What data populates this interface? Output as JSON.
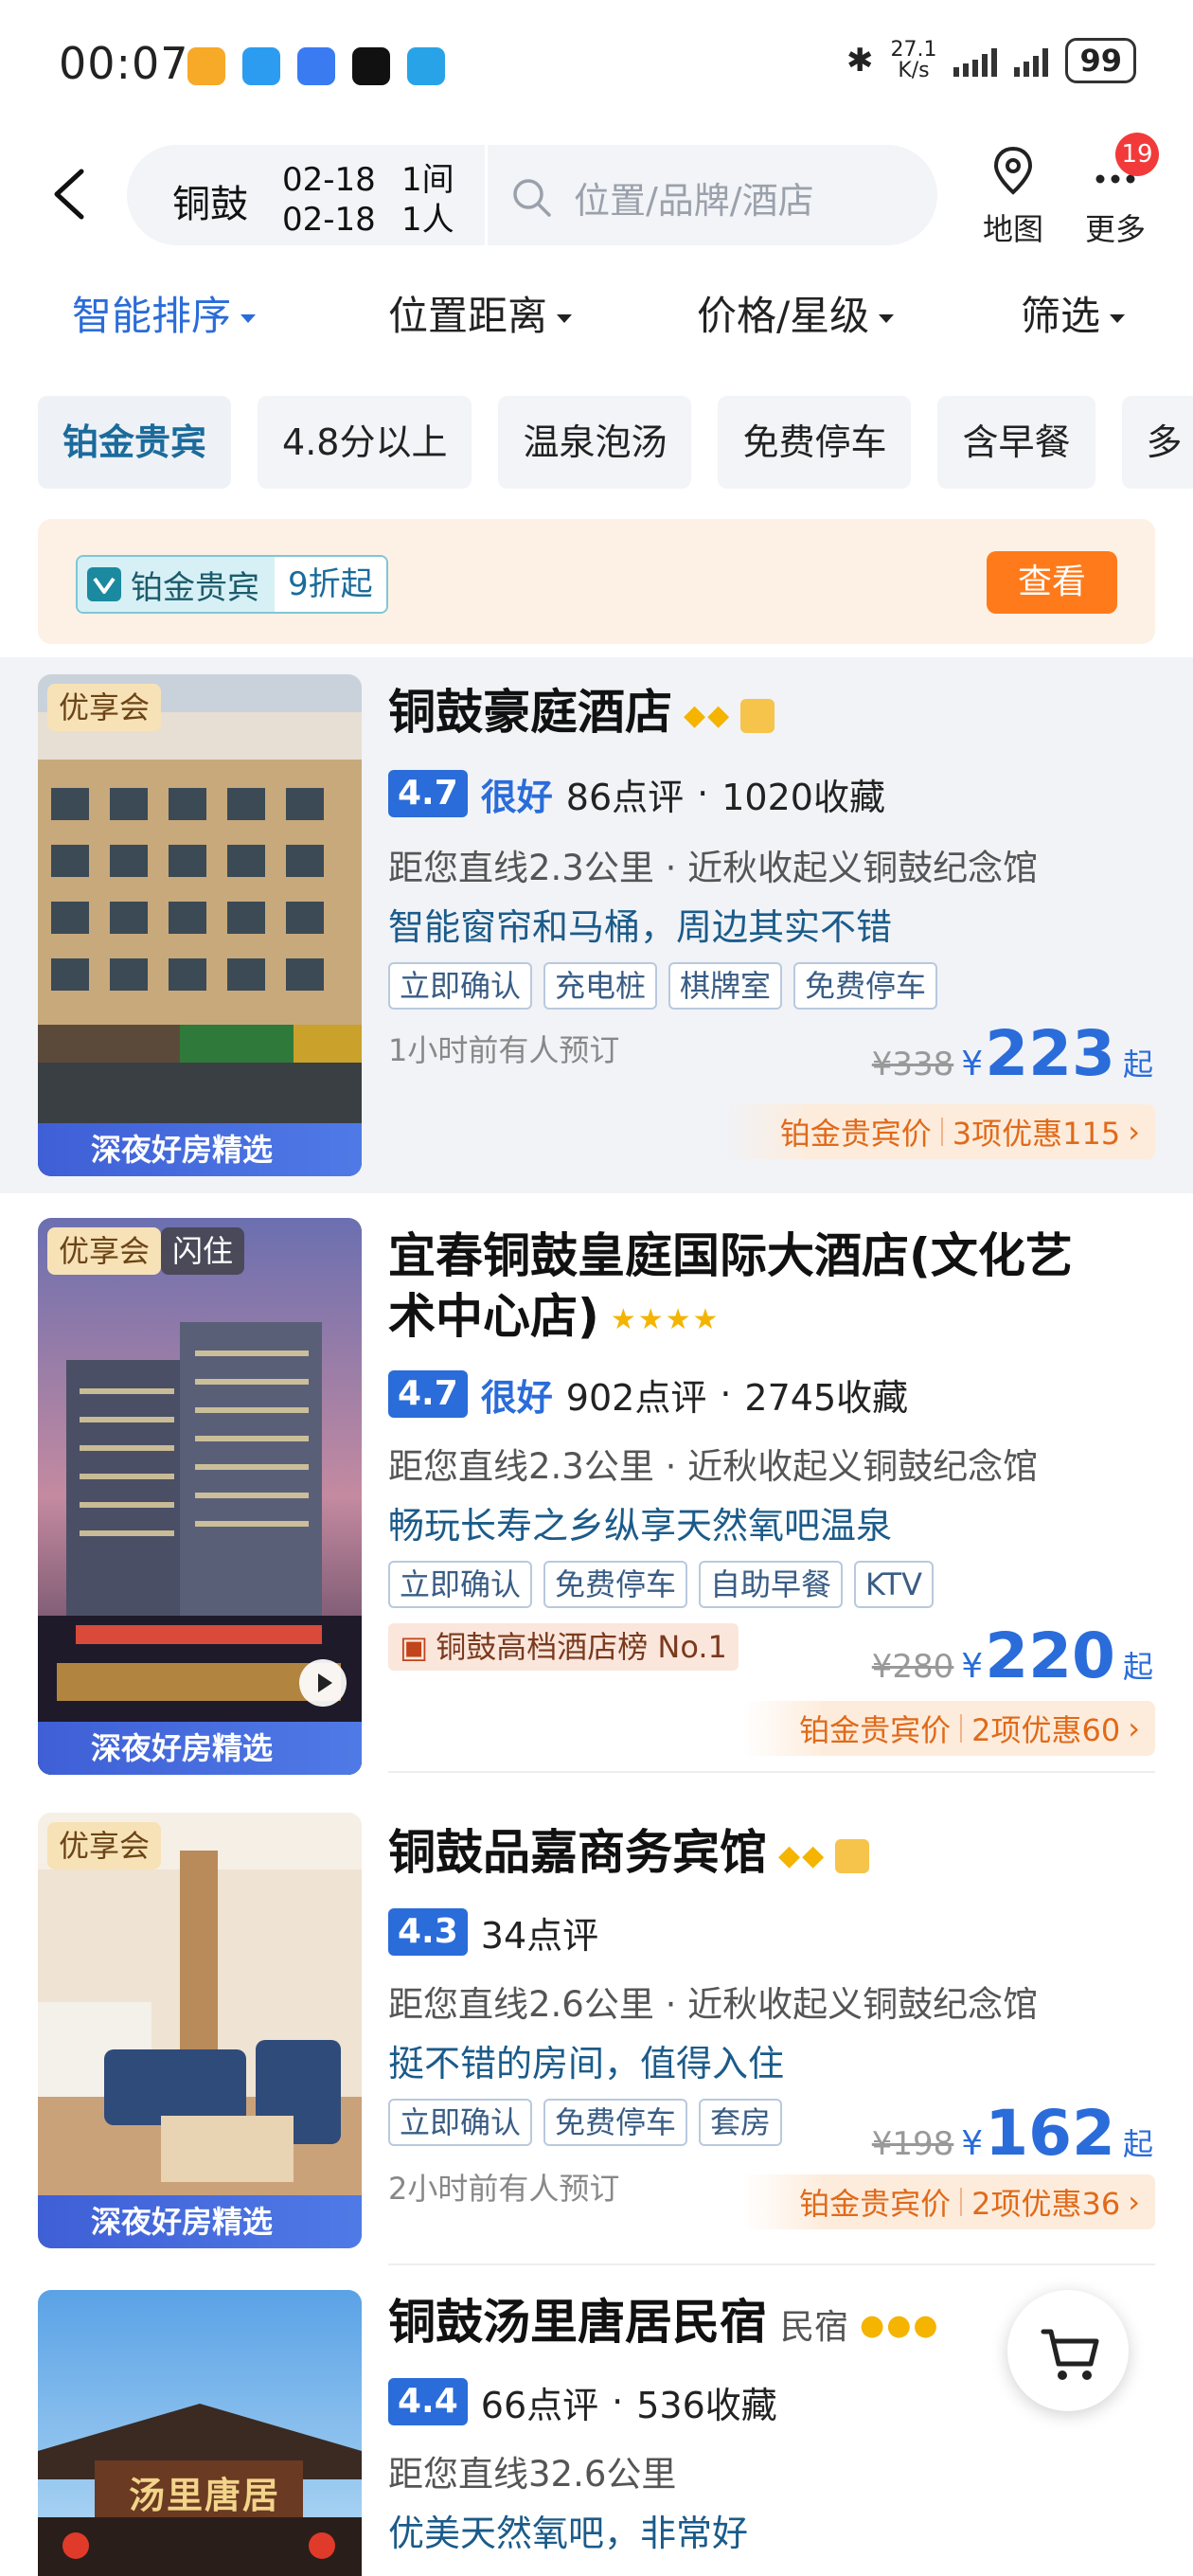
{
  "status_bar": {
    "time": "00:07",
    "net_speed_value": "27.1",
    "net_speed_unit": "K/s",
    "battery": "99"
  },
  "search": {
    "city": "铜鼓",
    "checkin": "02-18",
    "checkout": "02-18",
    "rooms": "1间",
    "guests": "1人",
    "placeholder": "位置/品牌/酒店"
  },
  "header": {
    "map_label": "地图",
    "more_label": "更多",
    "notification_count": "19"
  },
  "sort_tabs": [
    {
      "label": "智能排序",
      "active": true
    },
    {
      "label": "位置距离",
      "active": false
    },
    {
      "label": "价格/星级",
      "active": false
    },
    {
      "label": "筛选",
      "active": false
    }
  ],
  "filter_chips": [
    "铂金贵宾",
    "4.8分以上",
    "温泉泡汤",
    "免费停车",
    "含早餐",
    "多"
  ],
  "member_banner": {
    "vip_label": "铂金贵宾",
    "discount": "9折起",
    "button": "查看"
  },
  "hotels": [
    {
      "name": "铜鼓豪庭酒店",
      "photo_tags": [
        "优享会"
      ],
      "photo_banner": "深夜好房精选",
      "score": "4.7",
      "score_label": "很好",
      "reviews": "86点评",
      "favorites": "1020收藏",
      "distance": "距您直线2.3公里 · 近秋收起义铜鼓纪念馆",
      "highlight": "智能窗帘和马桶，周边其实不错",
      "tags": [
        "立即确认",
        "充电桩",
        "棋牌室",
        "免费停车"
      ],
      "recent": "1小时前有人预订",
      "original_price": "¥338",
      "currency": "¥",
      "price": "223",
      "price_suffix": "起",
      "deal_label": "铂金贵宾价",
      "deal_detail": "3项优惠115",
      "rating_icons": "◆◆"
    },
    {
      "name_line1": "宜春铜鼓皇庭国际大酒店(文化艺",
      "name_line2": "术中心店)",
      "photo_tags": [
        "优享会",
        "闪住"
      ],
      "photo_banner": "深夜好房精选",
      "score": "4.7",
      "score_label": "很好",
      "reviews": "902点评",
      "favorites": "2745收藏",
      "distance": "距您直线2.3公里 · 近秋收起义铜鼓纪念馆",
      "highlight": "畅玩长寿之乡纵享天然氧吧温泉",
      "tags": [
        "立即确认",
        "免费停车",
        "自助早餐",
        "KTV"
      ],
      "rank": "铜鼓高档酒店榜 No.1",
      "original_price": "¥280",
      "currency": "¥",
      "price": "220",
      "price_suffix": "起",
      "deal_label": "铂金贵宾价",
      "deal_detail": "2项优惠60",
      "rating_icons": "★★★★"
    },
    {
      "name": "铜鼓品嘉商务宾馆",
      "photo_tags": [
        "优享会"
      ],
      "photo_banner": "深夜好房精选",
      "score": "4.3",
      "reviews": "34点评",
      "distance": "距您直线2.6公里 · 近秋收起义铜鼓纪念馆",
      "highlight": "挺不错的房间，值得入住",
      "tags": [
        "立即确认",
        "免费停车",
        "套房"
      ],
      "recent": "2小时前有人预订",
      "original_price": "¥198",
      "currency": "¥",
      "price": "162",
      "price_suffix": "起",
      "deal_label": "铂金贵宾价",
      "deal_detail": "2项优惠36",
      "rating_icons": "◆◆"
    },
    {
      "name": "铜鼓汤里唐居民宿",
      "type_label": "民宿",
      "photo_sign": "汤里唐居",
      "score": "4.4",
      "reviews": "66点评",
      "favorites": "536收藏",
      "distance": "距您直线32.6公里",
      "highlight": "优美天然氧吧，非常好",
      "rating_icons": "●●●"
    }
  ],
  "colors": {
    "accent_blue": "#2a6cd9",
    "deal_orange": "#e06a1a",
    "button_orange": "#ff7a1a"
  }
}
